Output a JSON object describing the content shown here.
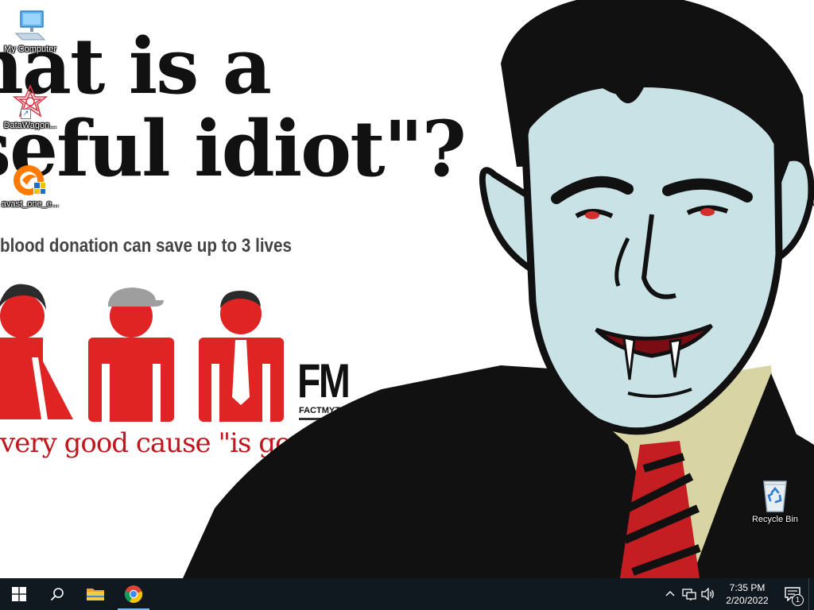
{
  "wallpaper": {
    "headline_line1": "hat is a",
    "headline_line2": "seful idiot\"?",
    "blood_text": "blood donation can save up to 3 lives",
    "fm_logo": "FM",
    "fm_site": "FACTMYTH.COM",
    "cause_text": "very good cause \"is good\".",
    "colors": {
      "red": "#e02424",
      "skin": "#c9e2e6",
      "shirt": "#d8d4a4"
    }
  },
  "desktop": {
    "icons": [
      {
        "label": "My Computer",
        "icon": "computer-icon"
      },
      {
        "label": "DataWagon...",
        "icon": "datawagon-icon"
      },
      {
        "label": "avast_one_e...",
        "icon": "avast-icon"
      },
      {
        "label": "Recycle Bin",
        "icon": "recycle-bin-icon"
      }
    ]
  },
  "taskbar": {
    "start_icon": "windows-logo-icon",
    "search_icon": "search-icon",
    "file_explorer_icon": "folder-icon",
    "chrome_icon": "chrome-icon",
    "tray": {
      "time": "7:35 PM",
      "date": "2/20/2022",
      "notification_count": "1"
    }
  }
}
